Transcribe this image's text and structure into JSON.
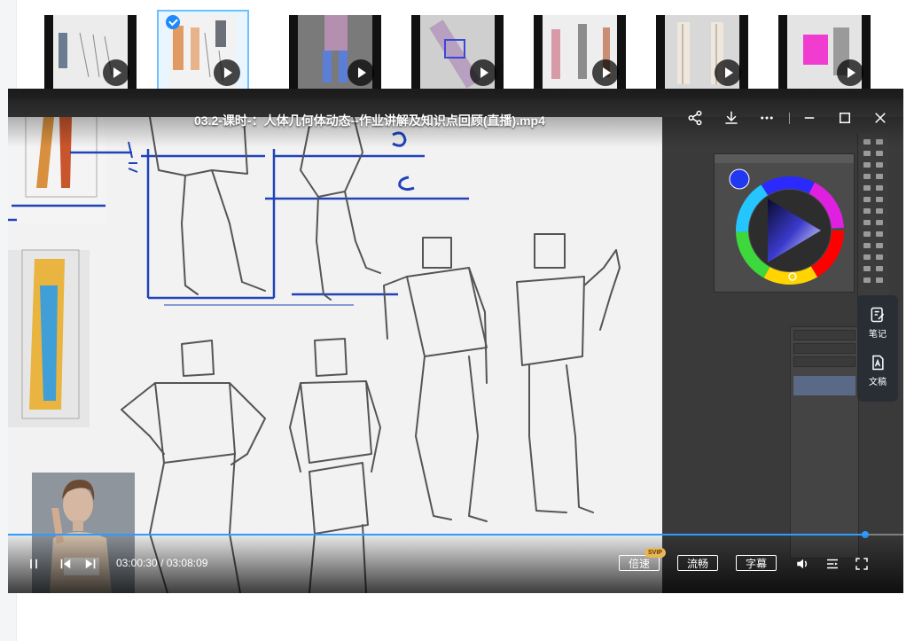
{
  "thumbnails": [
    {
      "id": "t1",
      "selected": false
    },
    {
      "id": "t2",
      "selected": true
    },
    {
      "id": "t3",
      "selected": false
    },
    {
      "id": "t4",
      "selected": false
    },
    {
      "id": "t5",
      "selected": false
    },
    {
      "id": "t6",
      "selected": false
    },
    {
      "id": "t7",
      "selected": false
    }
  ],
  "player": {
    "title": "03.2-课时-：人体几何体动态--作业讲解及知识点回顾(直播).mp4",
    "current_time": "03:00:30",
    "time_separator": "/",
    "duration": "03:08:09",
    "progress_fraction": 0.957,
    "speed_label": "倍速",
    "speed_badge": "SVIP",
    "quality_label": "流畅",
    "subtitle_label": "字幕",
    "accent_color": "#2e9bff",
    "side_panel": {
      "notes_label": "笔记",
      "doc_label": "文稿"
    },
    "icons": {
      "share": "share-icon",
      "download": "download-icon",
      "more": "more-icon",
      "minimize": "minimize-icon",
      "maximize": "maximize-icon",
      "close": "close-icon",
      "pause": "pause-icon",
      "prev": "skip-previous-icon",
      "next": "skip-next-icon",
      "volume": "volume-icon",
      "playlist": "playlist-icon",
      "fullscreen": "fullscreen-icon"
    }
  }
}
